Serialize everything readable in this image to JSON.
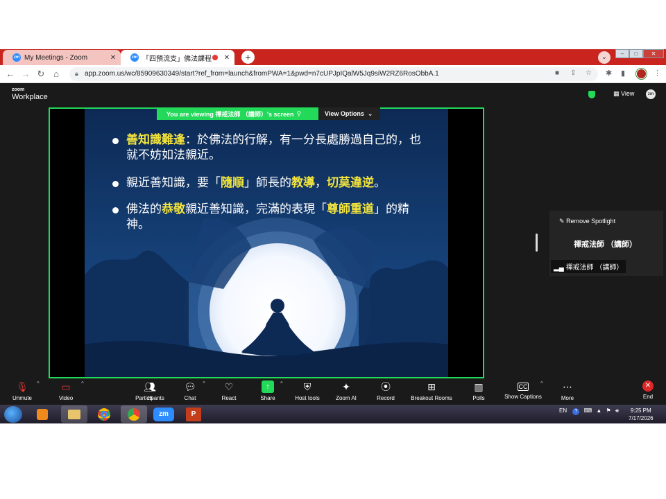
{
  "browser": {
    "tabs": [
      {
        "title": "My Meetings - Zoom",
        "favicon": "zm"
      },
      {
        "title": "「四預流支」佛法課程",
        "favicon": "zm"
      }
    ],
    "url": "app.zoom.us/wc/85909630349/start?ref_from=launch&fromPWA=1&pwd=n7cUPJpIQalW5Jq9siW2RZ6RosObbA.1"
  },
  "zoom_header": {
    "logo_top": "zoom",
    "logo_bottom": "Workplace",
    "view_label": "View",
    "avatar": "zm"
  },
  "share": {
    "banner": "You are viewing  禪戒法師 （講師）'s screen",
    "view_options": "View Options"
  },
  "slide": {
    "bullets": [
      {
        "parts": [
          {
            "text": "善知識難逢",
            "hl": true
          },
          {
            "text": "：於佛法的行解，有一分長處勝過自己的，也就不妨如法親近。",
            "hl": false
          }
        ]
      },
      {
        "parts": [
          {
            "text": "親近善知識，要「",
            "hl": false
          },
          {
            "text": "隨順",
            "hl": true
          },
          {
            "text": "」師長的",
            "hl": false
          },
          {
            "text": "教導",
            "hl": true
          },
          {
            "text": "，",
            "hl": false
          },
          {
            "text": "切莫違逆",
            "hl": true
          },
          {
            "text": "。",
            "hl": false
          }
        ]
      },
      {
        "parts": [
          {
            "text": "佛法的",
            "hl": false
          },
          {
            "text": "恭敬",
            "hl": true
          },
          {
            "text": "親近善知識，完滿的表現「",
            "hl": false
          },
          {
            "text": "尊師重道",
            "hl": true
          },
          {
            "text": "」的精神。",
            "hl": false
          }
        ]
      }
    ]
  },
  "participant_panel": {
    "remove_spotlight": "Remove Spotlight",
    "name": "禪戒法師 （講師）",
    "name_tag": "禪戒法師 （講師）"
  },
  "toolbar": {
    "participants_count": "25",
    "items": [
      {
        "label": "Unmute",
        "icon": "mic-muted-icon"
      },
      {
        "label": "Video",
        "icon": "video-off-icon"
      },
      {
        "label": "Participants",
        "icon": "participants-icon"
      },
      {
        "label": "Chat",
        "icon": "chat-icon"
      },
      {
        "label": "React",
        "icon": "heart-icon"
      },
      {
        "label": "Share",
        "icon": "share-icon"
      },
      {
        "label": "Host tools",
        "icon": "shield-icon"
      },
      {
        "label": "Zoom AI",
        "icon": "sparkle-icon"
      },
      {
        "label": "Record",
        "icon": "record-icon"
      },
      {
        "label": "Breakout Rooms",
        "icon": "grid-icon"
      },
      {
        "label": "Polls",
        "icon": "polls-icon"
      },
      {
        "label": "Show Captions",
        "icon": "cc-icon"
      },
      {
        "label": "More",
        "icon": "more-icon"
      },
      {
        "label": "End",
        "icon": "end-icon"
      }
    ]
  },
  "taskbar": {
    "language": "EN",
    "time": "9:25 PM",
    "date": "7/17/2026"
  },
  "colors": {
    "accent_green": "#23d959",
    "browser_red": "#c9251e",
    "highlight_yellow": "#f4e53b",
    "slide_blue": "#0d2e5c"
  }
}
